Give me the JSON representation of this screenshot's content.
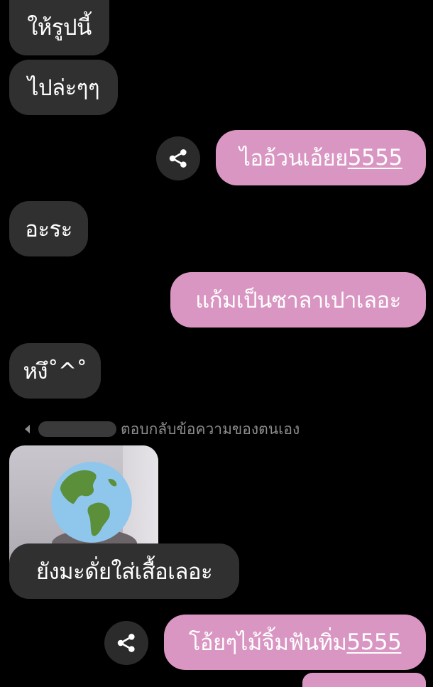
{
  "messages": [
    {
      "side": "in",
      "text": "ให้รูปนี้"
    },
    {
      "side": "in",
      "text": "ไปล่ะๆๆ"
    },
    {
      "side": "out",
      "text": "ไออ้วนเอ้ยย",
      "link": "5555",
      "share": true
    },
    {
      "side": "in",
      "text": "อะระ"
    },
    {
      "side": "out",
      "text": "แก้มเป็นซาลาเปาเลอะ"
    },
    {
      "side": "in",
      "text": "หงึ˚^˚"
    },
    {
      "side": "in",
      "text": "ยังมะดั่ยใส่เสื้อเลอะ"
    },
    {
      "side": "out",
      "text": "โอ้ยๆไม้จิ้มฟันทิ่ม",
      "link": "5555",
      "share": true
    }
  ],
  "reply_context": {
    "label": "ตอบกลับข้อความของตนเอง"
  },
  "photo": {
    "overlay_icon": "globe-emoji-icon"
  },
  "icons": {
    "share": "share-icon",
    "reply": "reply-arrow-icon"
  },
  "colors": {
    "background": "#000000",
    "incoming_bubble": "#303030",
    "outgoing_bubble": "#d996c2",
    "text": "#ffffff",
    "meta_text": "#8c8c8c"
  }
}
